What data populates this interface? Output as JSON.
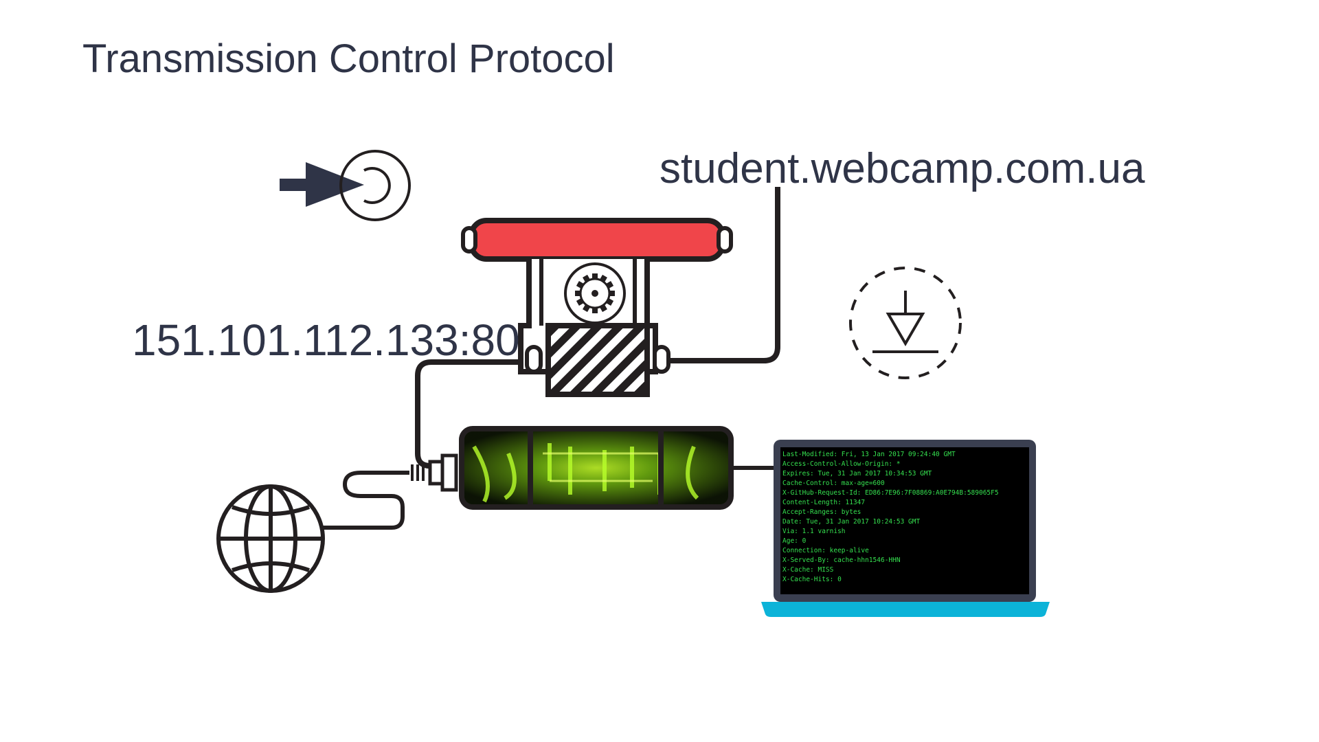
{
  "title": "Transmission Control Protocol",
  "host": "student.webcamp.com.ua",
  "address": "151.101.112.133:80",
  "colors": {
    "text": "#2f3447",
    "line": "#231f20",
    "button": "#f0454a",
    "laptop_frame": "#3a3f50",
    "laptop_base": "#0cb3d8",
    "terminal_text": "#35e04f"
  },
  "icons": [
    "arrow-into-target-icon",
    "gear-icon",
    "ground-symbol-icon",
    "globe-icon"
  ],
  "terminal": {
    "lines": [
      "Last-Modified: Fri, 13 Jan 2017 09:24:40 GMT",
      "Access-Control-Allow-Origin: *",
      "Expires: Tue, 31 Jan 2017 10:34:53 GMT",
      "Cache-Control: max-age=600",
      "X-GitHub-Request-Id: ED86:7E96:7F08869:A0E794B:589065F5",
      "Content-Length: 11347",
      "Accept-Ranges: bytes",
      "Date: Tue, 31 Jan 2017 10:24:53 GMT",
      "Via: 1.1 varnish",
      "Age: 0",
      "Connection: keep-alive",
      "X-Served-By: cache-hhn1546-HHN",
      "X-Cache: MISS",
      "X-Cache-Hits: 0"
    ]
  }
}
